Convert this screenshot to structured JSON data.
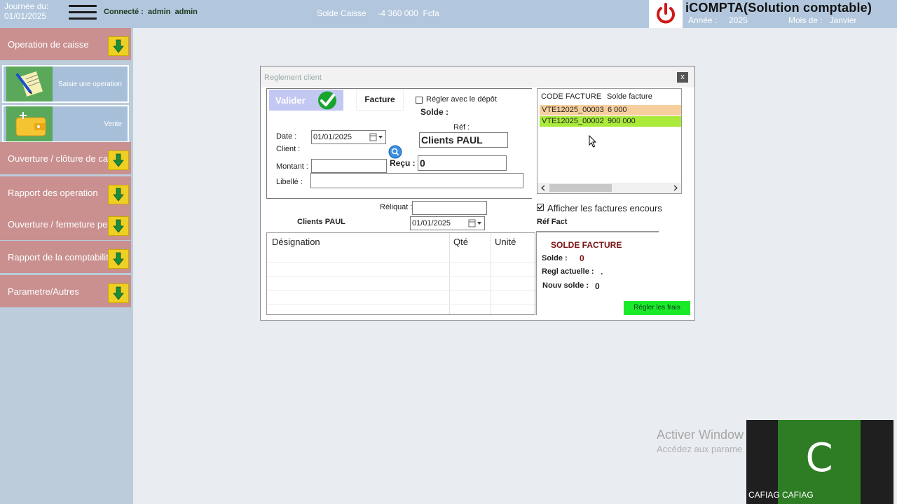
{
  "header": {
    "journee_line1": "Journée du:",
    "journee_line2": "01/01/2025",
    "connecte_label": "Connecté :",
    "user1": "admin",
    "user2": "admin",
    "solde_caisse_label": "Solde Caisse",
    "solde_caisse_value": "-4 360 000",
    "solde_caisse_currency": "Fcfa",
    "app_title": "iCOMPTA(Solution comptable)",
    "annee_label": "Année :",
    "annee_value": "2025",
    "mois_label": "Mois de :",
    "mois_value": "Janvier"
  },
  "sidebar": {
    "items": [
      {
        "label": "Operation de caisse"
      },
      {
        "label": "Ouverture / clôture de caisse"
      },
      {
        "label": "Rapport des operation"
      },
      {
        "label": "Ouverture / fermeture periode"
      },
      {
        "label": "Rapport de la  comptabilité"
      },
      {
        "label": "Parametre/Autres"
      }
    ],
    "sub_items": [
      {
        "label": "Saisie une operation",
        "icon": "notepad-pen-icon"
      },
      {
        "label": "Vente",
        "icon": "wallet-icon"
      }
    ]
  },
  "dialog": {
    "title": "Reglement client",
    "close_label": "x",
    "valider_label": "Valider",
    "facture_label": "Facture",
    "regler_depot_label": "Régler avec le dépôt",
    "solde_label": "Solde :",
    "date_label": "Date :",
    "date_value": "01/01/2025",
    "client_label": "Client :",
    "ref_label": "Réf :",
    "ref_value": "Clients PAUL",
    "montant_label": "Montant :",
    "montant_value": "",
    "recu_label": "Reçu :",
    "recu_value": "0",
    "libelle_label": "Libellé :",
    "libelle_value": "",
    "reliquat_label": "Réliquat :",
    "reliquat_value": "",
    "client_name": "Clients PAUL",
    "date2_value": "01/01/2025",
    "invoice_table": {
      "headers": [
        "CODE FACTURE",
        "Solde facture"
      ],
      "rows": [
        {
          "code": "VTE12025_00003",
          "solde": "6 000",
          "color": "#f7cf9e"
        },
        {
          "code": "VTE12025_00002",
          "solde": "900 000",
          "color": "#a9ea3b"
        }
      ]
    },
    "afficher_label": "Afficher les factures encours",
    "afficher_checked": true,
    "ref_fact_label": "Réf Fact",
    "designation_table": {
      "headers": [
        "Désignation",
        "Qté",
        "Unité"
      ]
    },
    "solde_facture": {
      "title": "SOLDE FACTURE",
      "solde_label": "Solde :",
      "solde_value": "0",
      "regl_label": "Regl actuelle :",
      "regl_value": ".",
      "nouv_label": "Nouv solde :",
      "nouv_value": "0"
    },
    "regler_frais_label": "Régler les frais"
  },
  "watermark": {
    "line1": "Activer Window",
    "line2": "Accédez aux parame"
  },
  "video": {
    "letter": "C",
    "name": "CAFIAG CAFIAG"
  },
  "colors": {
    "topbar": "#b2c7dd",
    "menu_item": "#c9908f",
    "arrow": "#f0cf24",
    "regler_button": "#1bea2a"
  }
}
